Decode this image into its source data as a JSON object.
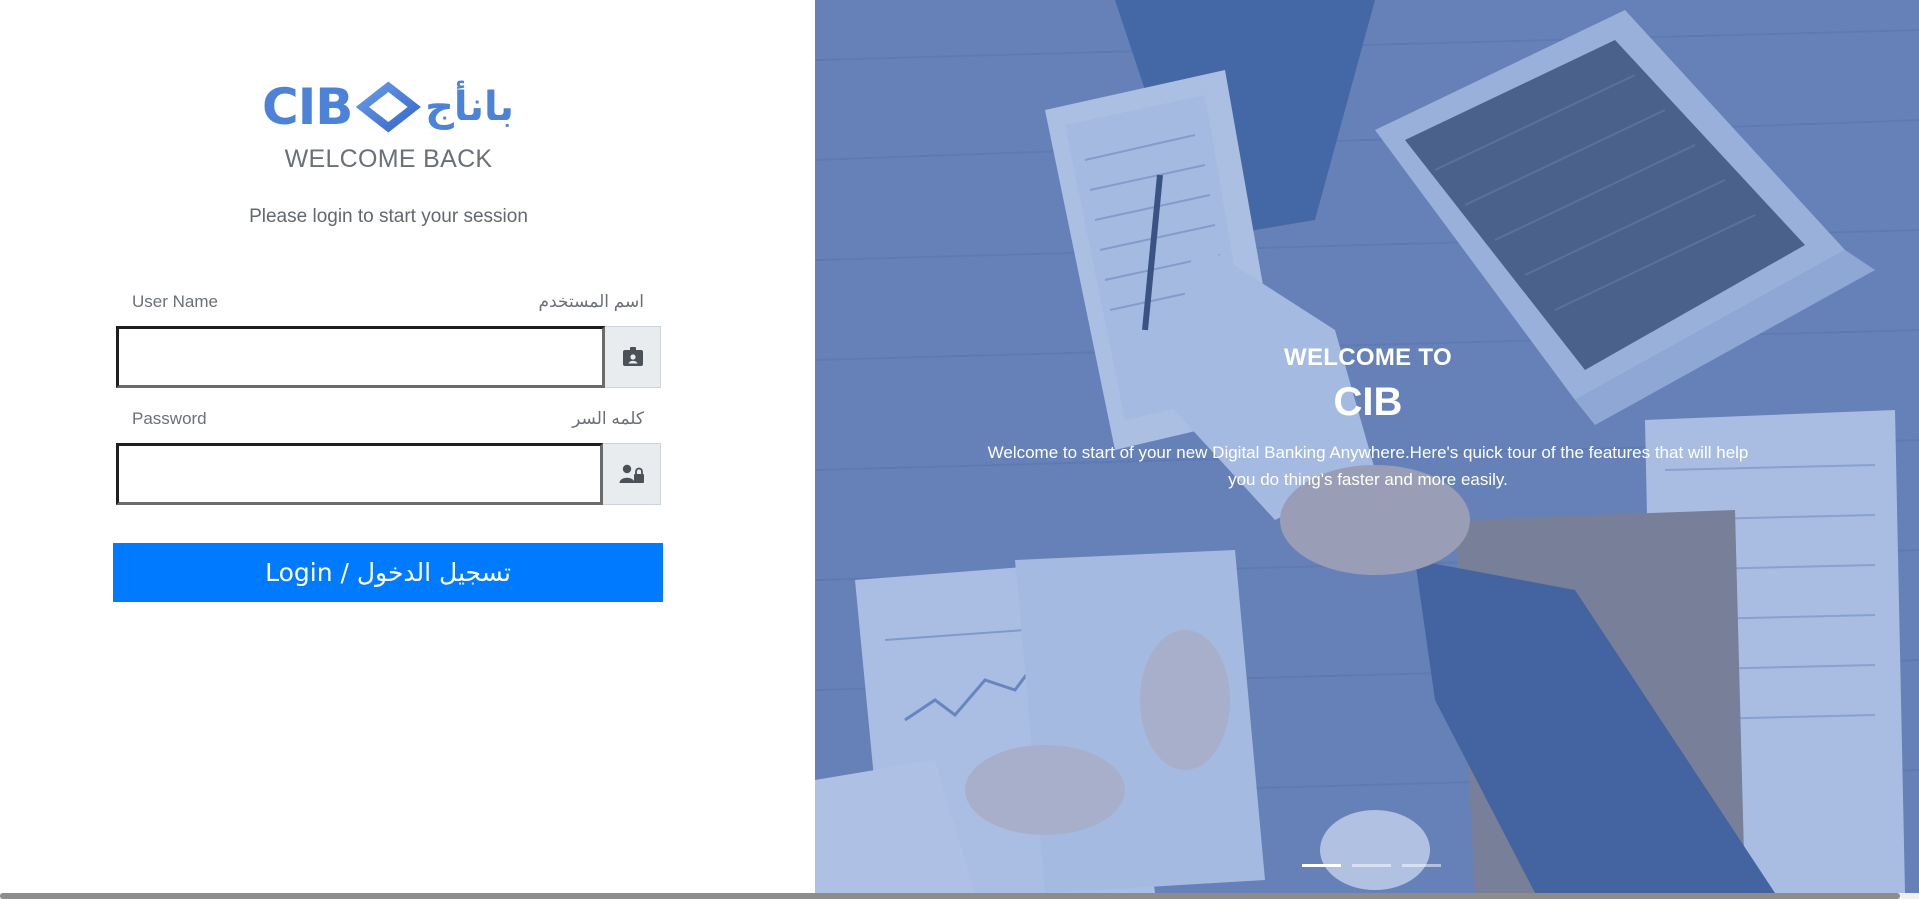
{
  "brand": {
    "logo_latin": "CIB",
    "logo_arabic": "بانأج",
    "accent_color": "#4c83d8"
  },
  "login": {
    "heading": "WELCOME BACK",
    "subtitle": "Please login to start your session",
    "username": {
      "label_en": "User Name",
      "label_ar": "اسم المستخدم",
      "value": "",
      "icon": "id-card-icon"
    },
    "password": {
      "label_en": "Password",
      "label_ar": "كلمه السر",
      "value": "",
      "icon": "user-lock-icon"
    },
    "submit_label": "Login / تسجيل الدخول",
    "button_color": "#007bff"
  },
  "hero": {
    "kicker": "WELCOME TO",
    "title": "CIB",
    "description": "Welcome to start of your new Digital Banking Anywhere.Here's quick tour of the features that will help you do thing's faster and more easily.",
    "overlay_color": "#6086cd",
    "slides": {
      "total": 3,
      "active": 1
    }
  }
}
